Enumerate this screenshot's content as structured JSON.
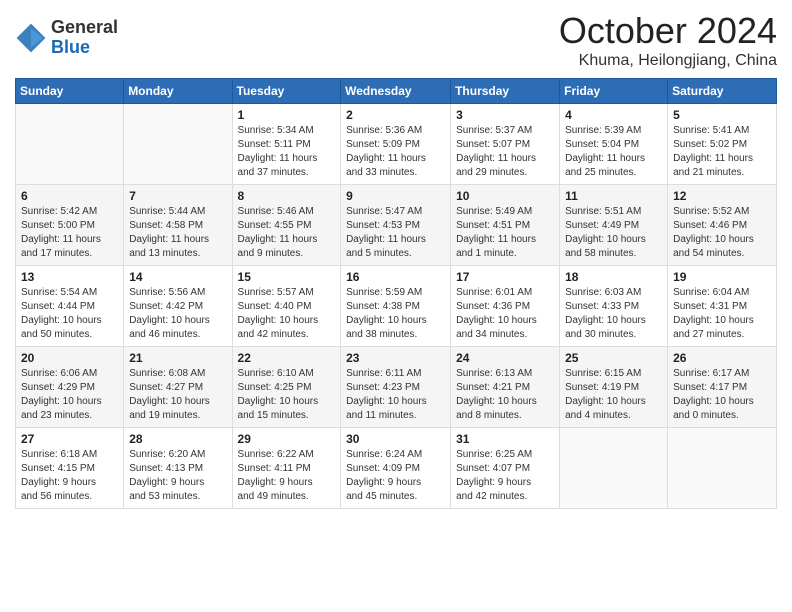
{
  "header": {
    "logo_general": "General",
    "logo_blue": "Blue",
    "title": "October 2024",
    "location": "Khuma, Heilongjiang, China"
  },
  "weekdays": [
    "Sunday",
    "Monday",
    "Tuesday",
    "Wednesday",
    "Thursday",
    "Friday",
    "Saturday"
  ],
  "weeks": [
    [
      {
        "day": "",
        "detail": ""
      },
      {
        "day": "",
        "detail": ""
      },
      {
        "day": "1",
        "detail": "Sunrise: 5:34 AM\nSunset: 5:11 PM\nDaylight: 11 hours\nand 37 minutes."
      },
      {
        "day": "2",
        "detail": "Sunrise: 5:36 AM\nSunset: 5:09 PM\nDaylight: 11 hours\nand 33 minutes."
      },
      {
        "day": "3",
        "detail": "Sunrise: 5:37 AM\nSunset: 5:07 PM\nDaylight: 11 hours\nand 29 minutes."
      },
      {
        "day": "4",
        "detail": "Sunrise: 5:39 AM\nSunset: 5:04 PM\nDaylight: 11 hours\nand 25 minutes."
      },
      {
        "day": "5",
        "detail": "Sunrise: 5:41 AM\nSunset: 5:02 PM\nDaylight: 11 hours\nand 21 minutes."
      }
    ],
    [
      {
        "day": "6",
        "detail": "Sunrise: 5:42 AM\nSunset: 5:00 PM\nDaylight: 11 hours\nand 17 minutes."
      },
      {
        "day": "7",
        "detail": "Sunrise: 5:44 AM\nSunset: 4:58 PM\nDaylight: 11 hours\nand 13 minutes."
      },
      {
        "day": "8",
        "detail": "Sunrise: 5:46 AM\nSunset: 4:55 PM\nDaylight: 11 hours\nand 9 minutes."
      },
      {
        "day": "9",
        "detail": "Sunrise: 5:47 AM\nSunset: 4:53 PM\nDaylight: 11 hours\nand 5 minutes."
      },
      {
        "day": "10",
        "detail": "Sunrise: 5:49 AM\nSunset: 4:51 PM\nDaylight: 11 hours\nand 1 minute."
      },
      {
        "day": "11",
        "detail": "Sunrise: 5:51 AM\nSunset: 4:49 PM\nDaylight: 10 hours\nand 58 minutes."
      },
      {
        "day": "12",
        "detail": "Sunrise: 5:52 AM\nSunset: 4:46 PM\nDaylight: 10 hours\nand 54 minutes."
      }
    ],
    [
      {
        "day": "13",
        "detail": "Sunrise: 5:54 AM\nSunset: 4:44 PM\nDaylight: 10 hours\nand 50 minutes."
      },
      {
        "day": "14",
        "detail": "Sunrise: 5:56 AM\nSunset: 4:42 PM\nDaylight: 10 hours\nand 46 minutes."
      },
      {
        "day": "15",
        "detail": "Sunrise: 5:57 AM\nSunset: 4:40 PM\nDaylight: 10 hours\nand 42 minutes."
      },
      {
        "day": "16",
        "detail": "Sunrise: 5:59 AM\nSunset: 4:38 PM\nDaylight: 10 hours\nand 38 minutes."
      },
      {
        "day": "17",
        "detail": "Sunrise: 6:01 AM\nSunset: 4:36 PM\nDaylight: 10 hours\nand 34 minutes."
      },
      {
        "day": "18",
        "detail": "Sunrise: 6:03 AM\nSunset: 4:33 PM\nDaylight: 10 hours\nand 30 minutes."
      },
      {
        "day": "19",
        "detail": "Sunrise: 6:04 AM\nSunset: 4:31 PM\nDaylight: 10 hours\nand 27 minutes."
      }
    ],
    [
      {
        "day": "20",
        "detail": "Sunrise: 6:06 AM\nSunset: 4:29 PM\nDaylight: 10 hours\nand 23 minutes."
      },
      {
        "day": "21",
        "detail": "Sunrise: 6:08 AM\nSunset: 4:27 PM\nDaylight: 10 hours\nand 19 minutes."
      },
      {
        "day": "22",
        "detail": "Sunrise: 6:10 AM\nSunset: 4:25 PM\nDaylight: 10 hours\nand 15 minutes."
      },
      {
        "day": "23",
        "detail": "Sunrise: 6:11 AM\nSunset: 4:23 PM\nDaylight: 10 hours\nand 11 minutes."
      },
      {
        "day": "24",
        "detail": "Sunrise: 6:13 AM\nSunset: 4:21 PM\nDaylight: 10 hours\nand 8 minutes."
      },
      {
        "day": "25",
        "detail": "Sunrise: 6:15 AM\nSunset: 4:19 PM\nDaylight: 10 hours\nand 4 minutes."
      },
      {
        "day": "26",
        "detail": "Sunrise: 6:17 AM\nSunset: 4:17 PM\nDaylight: 10 hours\nand 0 minutes."
      }
    ],
    [
      {
        "day": "27",
        "detail": "Sunrise: 6:18 AM\nSunset: 4:15 PM\nDaylight: 9 hours\nand 56 minutes."
      },
      {
        "day": "28",
        "detail": "Sunrise: 6:20 AM\nSunset: 4:13 PM\nDaylight: 9 hours\nand 53 minutes."
      },
      {
        "day": "29",
        "detail": "Sunrise: 6:22 AM\nSunset: 4:11 PM\nDaylight: 9 hours\nand 49 minutes."
      },
      {
        "day": "30",
        "detail": "Sunrise: 6:24 AM\nSunset: 4:09 PM\nDaylight: 9 hours\nand 45 minutes."
      },
      {
        "day": "31",
        "detail": "Sunrise: 6:25 AM\nSunset: 4:07 PM\nDaylight: 9 hours\nand 42 minutes."
      },
      {
        "day": "",
        "detail": ""
      },
      {
        "day": "",
        "detail": ""
      }
    ]
  ]
}
